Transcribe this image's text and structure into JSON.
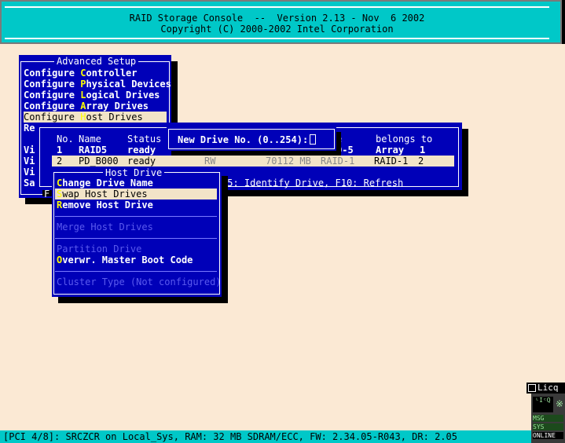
{
  "header": {
    "line1": "RAID Storage Console  --  Version 2.13 - Nov  6 2002",
    "line2": "Copyright (C) 2000-2002 Intel Corporation"
  },
  "advanced_setup": {
    "title": "Advanced Setup",
    "items": [
      {
        "pre": "Configure ",
        "key": "C",
        "post": "ontroller"
      },
      {
        "pre": "Configure ",
        "key": "P",
        "post": "hysical Devices"
      },
      {
        "pre": "Configure ",
        "key": "L",
        "post": "ogical Drives"
      },
      {
        "pre": "Configure ",
        "key": "A",
        "post": "rray Drives"
      },
      {
        "pre": "Configure ",
        "key": "H",
        "post": "ost Drives"
      }
    ],
    "partial_items": [
      "Re",
      "Vi",
      "Vi",
      "Vi",
      "Sa"
    ]
  },
  "host_drive_list": {
    "headers": {
      "no": "No.",
      "name": "Name",
      "status": "Status",
      "type_tail": "e",
      "belongs_to": "belongs to"
    },
    "rows": [
      {
        "no": "1",
        "name": "RAID5",
        "status": "ready",
        "type_tail": "D-5",
        "belongs_type": "Array",
        "belongs_no": "1"
      },
      {
        "no": "2",
        "name": "PD_B000",
        "status": "ready",
        "attr": "RW",
        "size": "70112 MB",
        "type": "RAID-1",
        "belongs_type": "RAID-1",
        "belongs_no": "2"
      }
    ],
    "hint_prefix": "F",
    "hint": "F5: Identify Drive, F10: Refresh"
  },
  "new_drive_prompt": {
    "label": "New Drive No. (0..254):",
    "value": ""
  },
  "host_drive_menu": {
    "title": "Host Drive",
    "items": [
      {
        "key": "C",
        "post": "hange Drive Name",
        "enabled": true
      },
      {
        "key": "S",
        "post": "wap Host Drives",
        "enabled": true
      },
      {
        "key": "R",
        "post": "emove Host Drive",
        "enabled": true
      },
      {
        "label": "Merge Host Drives",
        "enabled": false
      },
      {
        "label": "Partition Drive",
        "enabled": false
      },
      {
        "key": "O",
        "post": "verwr. Master Boot Code",
        "enabled": true
      },
      {
        "label": "Cluster Type (Not configured)",
        "enabled": false
      }
    ]
  },
  "status_bar": {
    "text": "[PCI 4/8]: SRCZCR on Local_Sys, RAM: 32 MB SDRAM/ECC, FW: 2.34.05-R043, DR: 2.05"
  },
  "licq": {
    "title": "Licq",
    "buttons": [
      "MSG",
      "SYS",
      "ONLINE"
    ]
  },
  "colors": {
    "desktop": "#fbe9d4",
    "header": "#00c8c8",
    "window": "#0000b8",
    "hotkey": "#ffff00",
    "selection": "#f2e4c8",
    "disabled": "#5a5aee"
  }
}
